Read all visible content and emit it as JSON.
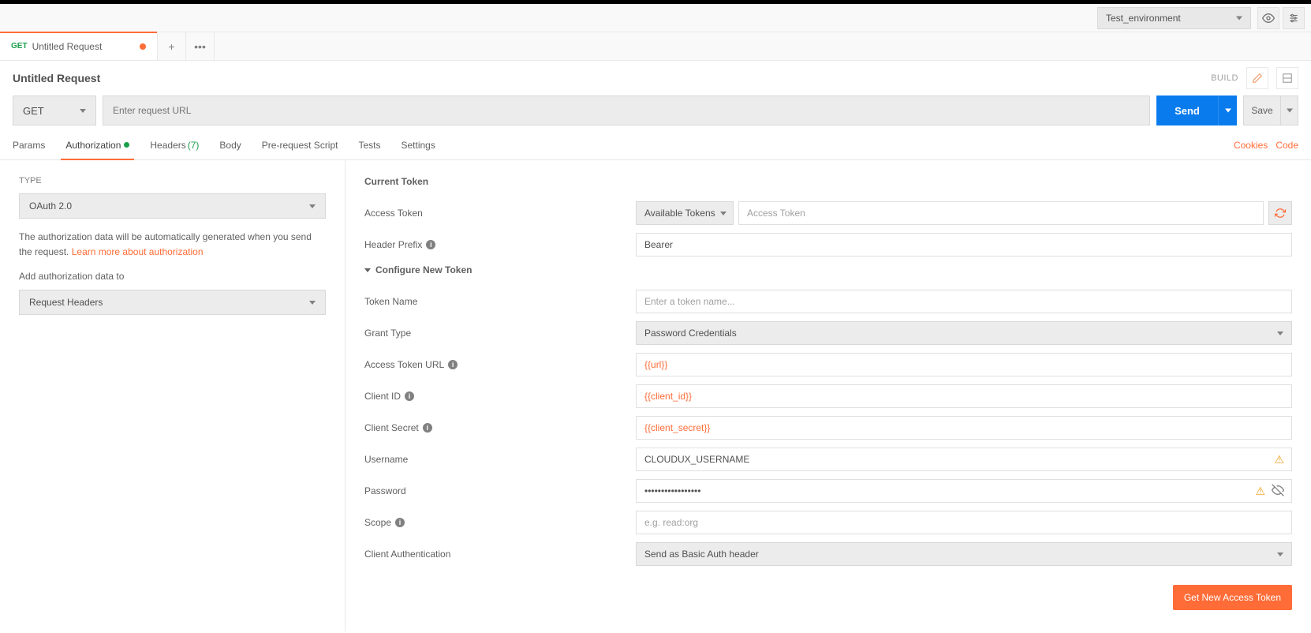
{
  "env": {
    "selected": "Test_environment"
  },
  "tab": {
    "method": "GET",
    "name": "Untitled Request"
  },
  "title": "Untitled Request",
  "build": "BUILD",
  "urlbar": {
    "method": "GET",
    "url_placeholder": "Enter request URL",
    "send": "Send",
    "save": "Save"
  },
  "subtabs": {
    "params": "Params",
    "auth": "Authorization",
    "headers": "Headers",
    "headers_count": "(7)",
    "body": "Body",
    "prereq": "Pre-request Script",
    "tests": "Tests",
    "settings": "Settings",
    "cookies": "Cookies",
    "code": "Code"
  },
  "sidebar": {
    "type_label": "TYPE",
    "type_value": "OAuth 2.0",
    "help1": "The authorization data will be automatically generated when you send the request. ",
    "help_link": "Learn more about authorization",
    "addto_label": "Add authorization data to",
    "addto_value": "Request Headers"
  },
  "current_token": {
    "title": "Current Token",
    "access_token_label": "Access Token",
    "available": "Available Tokens",
    "access_token_placeholder": "Access Token",
    "prefix_label": "Header Prefix",
    "prefix_value": "Bearer"
  },
  "config": {
    "title": "Configure New Token",
    "token_name_label": "Token Name",
    "token_name_placeholder": "Enter a token name...",
    "grant_label": "Grant Type",
    "grant_value": "Password Credentials",
    "url_label": "Access Token URL",
    "url_value": "{{url}}",
    "client_id_label": "Client ID",
    "client_id_value": "{{client_id}}",
    "client_secret_label": "Client Secret",
    "client_secret_value": "{{client_secret}}",
    "username_label": "Username",
    "username_value": "CLOUDUX_USERNAME",
    "password_label": "Password",
    "password_value": "•••••••••••••••••",
    "scope_label": "Scope",
    "scope_placeholder": "e.g. read:org",
    "client_auth_label": "Client Authentication",
    "client_auth_value": "Send as Basic Auth header",
    "get_token_btn": "Get New Access Token"
  }
}
